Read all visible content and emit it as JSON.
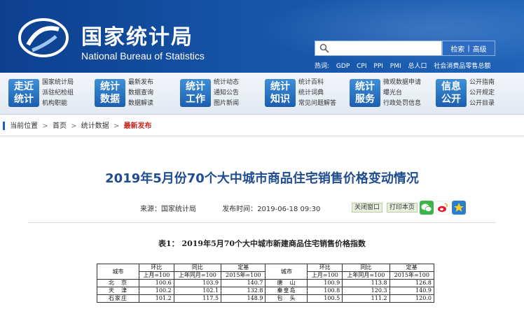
{
  "header": {
    "logo_cn": "国家统计局",
    "logo_en": "National Bureau of Statistics",
    "search_button": "检索",
    "advanced_button": "高级",
    "hot_label": "热词:",
    "hot_words": [
      "GDP",
      "CPI",
      "PPI",
      "PMI",
      "总人口",
      "社会消费品零售总额"
    ]
  },
  "nav": [
    {
      "badge": "走近统计",
      "links": [
        "国家统计局",
        "派驻纪检组",
        "机构职能"
      ]
    },
    {
      "badge": "统计数据",
      "links": [
        "最新发布",
        "数据查询",
        "数据解读"
      ]
    },
    {
      "badge": "统计工作",
      "links": [
        "统计动态",
        "通知公告",
        "图片新闻"
      ]
    },
    {
      "badge": "统计知识",
      "links": [
        "统计百科",
        "统计词典",
        "常见问题解答"
      ]
    },
    {
      "badge": "统计服务",
      "links": [
        "微观数据申请",
        "曝光台",
        "行政处罚信息"
      ]
    },
    {
      "badge": "信息公开",
      "links": [
        "公开指南",
        "公开规定",
        "公开目录"
      ]
    }
  ],
  "breadcrumb": {
    "current_label": "当前位置",
    "items": [
      "首页",
      "统计数据"
    ],
    "current": "最新发布"
  },
  "article": {
    "title": "2019年5月份70个大中城市商品住宅销售价格变动情况",
    "source_label": "来源：",
    "source": "国家统计局",
    "time_label": "发布时间：",
    "time": "2019-06-18 09:30",
    "close_button": "关闭窗口",
    "print_button": "打印本页"
  },
  "table": {
    "caption": "表1：  2019年5月70个大中城市新建商品住宅销售价格指数",
    "headers": {
      "city": "城市",
      "mom": "环比",
      "yoy": "同比",
      "fixed": "定基",
      "mom_sub": "上月=100",
      "yoy_sub": "上年同月=100",
      "fixed_sub": "2015年=100"
    },
    "rows": [
      {
        "c1": "北　京",
        "a1": "100.6",
        "b1": "103.9",
        "d1": "140.7",
        "c2": "唐　山",
        "a2": "100.9",
        "b2": "113.8",
        "d2": "126.8"
      },
      {
        "c1": "天　津",
        "a1": "100.2",
        "b1": "102.1",
        "d1": "132.8",
        "c2": "秦皇岛",
        "a2": "100.8",
        "b2": "120.3",
        "d2": "140.9"
      },
      {
        "c1": "石家庄",
        "a1": "101.2",
        "b1": "117.5",
        "d1": "148.9",
        "c2": "包　头",
        "a2": "100.5",
        "b2": "111.2",
        "d2": "120.0"
      }
    ]
  },
  "colors": {
    "header_blue": "#1553a6",
    "title_blue": "#1f4d8f",
    "breadcrumb_red": "#c8281e"
  }
}
